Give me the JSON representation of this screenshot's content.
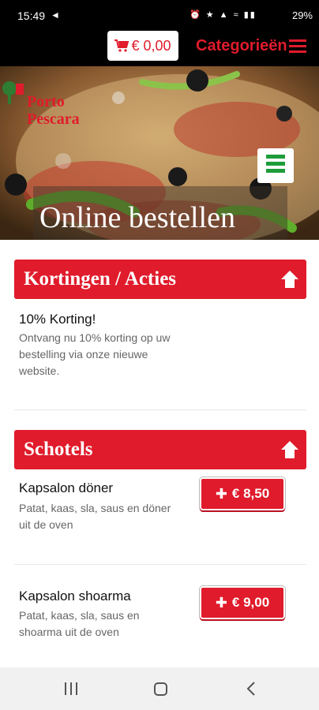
{
  "status_bar": {
    "time": "15:49",
    "battery": "29%",
    "icons": [
      "alarm-icon",
      "bluetooth-icon",
      "mute-icon",
      "wifi-icon",
      "signal-icon",
      "signal-icon"
    ]
  },
  "topnav": {
    "cart_amount": "€ 0,00",
    "categories_label": "Categorieën"
  },
  "hero": {
    "logo_line1": "Porto",
    "logo_line2": "Pescara",
    "title": "Online bestellen"
  },
  "sections": {
    "kortingen": {
      "title": "Kortingen / Acties",
      "items": [
        {
          "title": "10% Korting!",
          "desc": "Ontvang nu 10% korting op uw bestelling via onze nieuwe website."
        }
      ]
    },
    "schotels": {
      "title": "Schotels",
      "items": [
        {
          "title": "Kapsalon döner",
          "desc": "Patat, kaas, sla, saus en döner uit de oven",
          "price": "€ 8,50"
        },
        {
          "title": "Kapsalon shoarma",
          "desc": "Patat, kaas, sla, saus en shoarma uit de oven",
          "price": "€ 9,00"
        }
      ]
    }
  },
  "colors": {
    "brand_red": "#e01b2b",
    "menu_green": "#1d9c3a"
  }
}
